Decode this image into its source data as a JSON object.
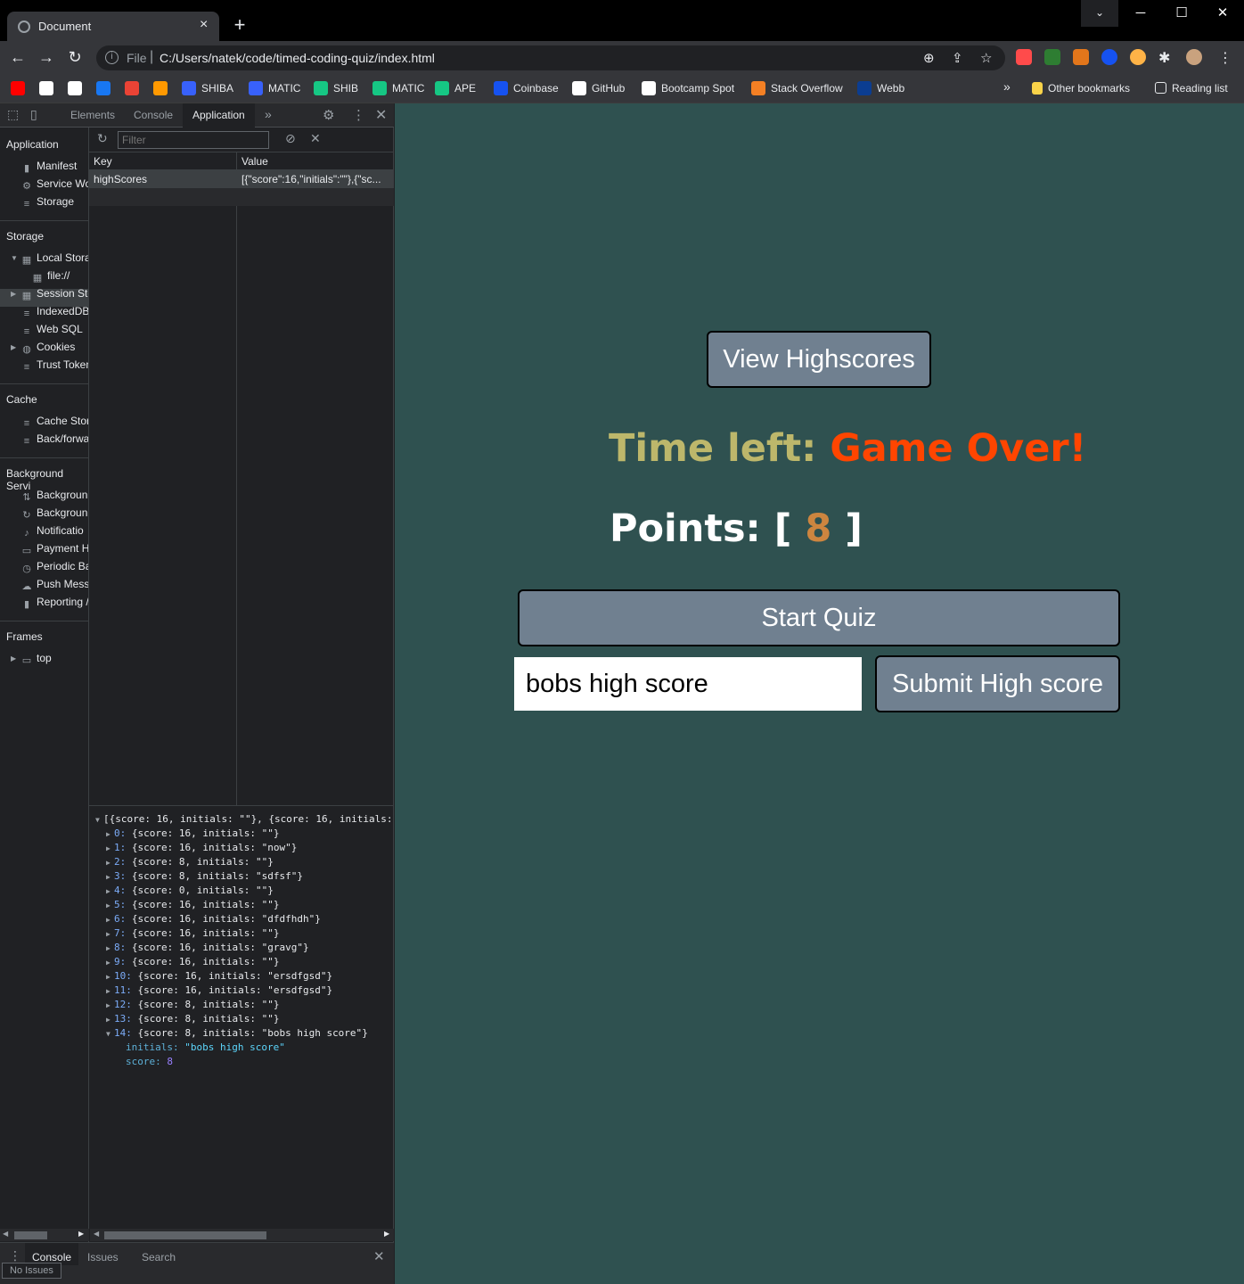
{
  "browser": {
    "tab_title": "Document",
    "url_scheme_label": "File",
    "url": "C:/Users/natek/code/timed-coding-quiz/index.html",
    "bookmarks": [
      {
        "label": "",
        "icon": "youtube-icon",
        "color": "#ff0000"
      },
      {
        "label": "",
        "icon": "rocket-icon",
        "color": "#ffffff"
      },
      {
        "label": "",
        "icon": "amazon-icon",
        "color": "#ffffff"
      },
      {
        "label": "",
        "icon": "facebook-icon",
        "color": "#1877f2"
      },
      {
        "label": "",
        "icon": "gmail-icon",
        "color": "#ea4335"
      },
      {
        "label": "",
        "icon": "paw-icon",
        "color": "#ff9900"
      },
      {
        "label": "SHIBA",
        "icon": "coinmarket-icon",
        "color": "#3861fb"
      },
      {
        "label": "MATIC",
        "icon": "coinmarket-icon",
        "color": "#3861fb"
      },
      {
        "label": "SHIB",
        "icon": "chart-icon",
        "color": "#16c784"
      },
      {
        "label": "MATIC",
        "icon": "chart-icon",
        "color": "#16c784"
      },
      {
        "label": "APE",
        "icon": "chart-icon",
        "color": "#16c784"
      },
      {
        "label": "Coinbase",
        "icon": "coinbase-icon",
        "color": "#1652f0"
      },
      {
        "label": "GitHub",
        "icon": "github-icon",
        "color": "#ffffff"
      },
      {
        "label": "Bootcamp Spot",
        "icon": "bootcamp-icon",
        "color": "#ffffff"
      },
      {
        "label": "Stack Overflow",
        "icon": "stackoverflow-icon",
        "color": "#f48024"
      },
      {
        "label": "Webb",
        "icon": "nasa-icon",
        "color": "#0b3d91"
      }
    ],
    "overflow_label": "»",
    "other_bookmarks": "Other bookmarks",
    "reading_list": "Reading list"
  },
  "devtools": {
    "tabs": [
      "Elements",
      "Console",
      "Application"
    ],
    "active_tab": "Application",
    "more_tabs": "»",
    "sidebar": {
      "application_header": "Application",
      "application_items": [
        "Manifest",
        "Service Wo",
        "Storage"
      ],
      "storage_header": "Storage",
      "storage_items": [
        "Local Stora",
        "file://",
        "Session Sto",
        "IndexedDB",
        "Web SQL",
        "Cookies",
        "Trust Token"
      ],
      "cache_header": "Cache",
      "cache_items": [
        "Cache Stor",
        "Back/forwa"
      ],
      "background_header": "Background Servi",
      "background_items": [
        "Backgroun",
        "Backgroun",
        "Notificatio",
        "Payment H",
        "Periodic Ba",
        "Push Mess",
        "Reporting /"
      ],
      "frames_header": "Frames",
      "frames_items": [
        "top"
      ]
    },
    "filter_placeholder": "Filter",
    "grid": {
      "col_key": "Key",
      "col_value": "Value",
      "rows": [
        {
          "key": "highScores",
          "value": "[{\"score\":16,\"initials\":\"\"},{\"sc..."
        }
      ]
    },
    "preview": {
      "summary": "[{score: 16, initials: \"\"}, {score: 16, initials:",
      "items": [
        {
          "idx": "0",
          "score": "16",
          "initials": "\"\""
        },
        {
          "idx": "1",
          "score": "16",
          "initials": "\"now\""
        },
        {
          "idx": "2",
          "score": "8",
          "initials": "\"\""
        },
        {
          "idx": "3",
          "score": "8",
          "initials": "\"sdfsf\""
        },
        {
          "idx": "4",
          "score": "0",
          "initials": "\"\""
        },
        {
          "idx": "5",
          "score": "16",
          "initials": "\"\""
        },
        {
          "idx": "6",
          "score": "16",
          "initials": "\"dfdfhdh\""
        },
        {
          "idx": "7",
          "score": "16",
          "initials": "\"\""
        },
        {
          "idx": "8",
          "score": "16",
          "initials": "\"gravg\""
        },
        {
          "idx": "9",
          "score": "16",
          "initials": "\"\""
        },
        {
          "idx": "10",
          "score": "16",
          "initials": "\"ersdfgsd\""
        },
        {
          "idx": "11",
          "score": "16",
          "initials": "\"ersdfgsd\""
        },
        {
          "idx": "12",
          "score": "8",
          "initials": "\"\""
        },
        {
          "idx": "13",
          "score": "8",
          "initials": "\"\""
        },
        {
          "idx": "14",
          "score": "8",
          "initials": "\"bobs high score\""
        }
      ],
      "expanded_initials_key": "initials",
      "expanded_initials_value": "\"bobs high score\"",
      "expanded_score_key": "score",
      "expanded_score_value": "8"
    },
    "drawer": {
      "tabs": [
        "Console",
        "Issues",
        "Search"
      ],
      "active_tab": "Console",
      "status": "No Issues"
    }
  },
  "page": {
    "view_highscores": "View Highscores",
    "time_label": "Time left:",
    "time_value": "Game Over!",
    "points_label": "Points:",
    "points_open": "[",
    "points_value": "8",
    "points_close": "]",
    "start_quiz": "Start Quiz",
    "initials_value": "bobs high score",
    "submit_label": "Submit High score",
    "colors": {
      "background": "#2f5150",
      "button": "#708090",
      "time_label": "#bdb76b",
      "time_value": "#ff4500",
      "points_value": "#cd853f"
    }
  }
}
